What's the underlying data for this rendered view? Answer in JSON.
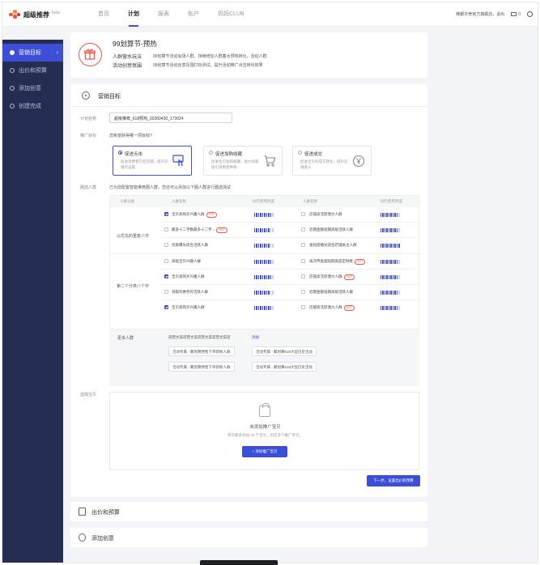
{
  "app": {
    "name": "超级推荐",
    "badge": "beta"
  },
  "nav": [
    "首页",
    "计划",
    "报表",
    "账户",
    "妈妈CLUB"
  ],
  "top_right": {
    "user": "韩都衣舍官方旗舰店，退出",
    "messages": "0"
  },
  "sidebar": [
    {
      "label": "营销目标",
      "active": true
    },
    {
      "label": "出价和预算"
    },
    {
      "label": "添加创意"
    },
    {
      "label": "创建完成"
    }
  ],
  "hero": {
    "title": "99划算节-预热",
    "rows": [
      {
        "key": "人群营水玩法",
        "value": "99划算节活动会场人群，持续增加人群蓄水预热转化，活动人群"
      },
      {
        "key": "活动创意氛围",
        "value": "99划算节活动创意氛围打标测试，提升活动推广点击转化效果"
      }
    ]
  },
  "marketing": {
    "section_title": "营销目标",
    "plan_name_label": "计划名称",
    "plan_name_value": "超级推荐_618预热_20260430_173024",
    "goal_label": "推广目标",
    "goal_question": "您希望获得哪一项目标?",
    "goals": [
      {
        "title": "促进点击",
        "desc": "促进消费者在您店铺，提升店铺点击量",
        "selected": true
      },
      {
        "title": "促进加购收藏",
        "desc": "促进宝贝加购收藏，助力商家吸引消费者种草"
      },
      {
        "title": "促进成交",
        "desc": "促进宝贝的成交转化，提升店铺收入"
      }
    ],
    "audience_label": "圈选人群",
    "audience_note": "已为您配置智能推荐圈人群，您还可以添加以下圈人群进行圈选测试",
    "table_headers": [
      "人群分类",
      "人群名称",
      "同行使用热度",
      "人群名称",
      "同行使用热度"
    ],
    "groups": [
      {
        "label": "以优先的重复八字"
      },
      {
        "label": "第二个分类八个字"
      }
    ],
    "rows": [
      {
        "left": {
          "name": "宝贝高购买兴趣人群",
          "tag": "HOT",
          "checked": true
        },
        "right": {
          "name": "店铺高活跃潜力人群"
        },
        "heat_l": 9,
        "heat_r": 9
      },
      {
        "left": {
          "name": "最多十二字数最多十二字...",
          "tag": "HOT"
        },
        "right": {
          "name": "近期金额短期高级活跃人群"
        },
        "heat_l": 8,
        "heat_r": 9
      },
      {
        "left": {
          "name": "优质曝光适合活跃人群"
        },
        "right": {
          "name": "金短搭播光适合店铺关注人群"
        },
        "heat_l": 8,
        "heat_r": 10
      },
      {
        "left": {
          "name": "高级宝贝兴趣人群"
        },
        "right": {
          "name": "再次传金越短期高度定制者",
          "tag": "HOT"
        },
        "heat_l": 9,
        "heat_r": 9
      },
      {
        "left": {
          "name": "宝贝高购买兴趣人群",
          "checked": true
        },
        "right": {
          "name": "店铺高活跃潜力人群",
          "tag": "HOT"
        },
        "heat_l": 9,
        "heat_r": 9
      },
      {
        "left": {
          "name": "领取优惠券的活跃人群"
        },
        "right": {
          "name": "近期金额短期高级活跃人群"
        },
        "heat_l": 8,
        "heat_r": 9
      },
      {
        "left": {
          "name": "宝贝高购买兴趣人群",
          "checked": true
        },
        "right": {
          "name": "店铺高活跃潜力人群",
          "tag": "HOT"
        },
        "heat_l": 9,
        "heat_r": 9
      }
    ],
    "more": {
      "label": "更多人群",
      "text": "适营文案适营文案适营文案适营文案适",
      "link": "添加",
      "chips": [
        "活动专属 - 聚划算预售下单新盼人群",
        "活动专属 - 聚划算618大促历史活动",
        "活动专属 - 聚划算预售下单新盼人群",
        "活动专属 - 聚划算618大促历史活动"
      ]
    },
    "products_label": "选择宝贝",
    "products_empty": "未添加推广宝贝",
    "products_hint": "单次最多添加 20 个宝贝，您还多个推广单元。",
    "add_button": "+ 添加推广宝贝",
    "next_button": "下一步，设置出价和预算"
  },
  "collapsed": [
    {
      "title": "出价和预算"
    },
    {
      "title": "添加创意"
    }
  ],
  "colors": {
    "accent": "#3b4fd8",
    "sidebar": "#252d52",
    "hot": "#e9574a"
  }
}
